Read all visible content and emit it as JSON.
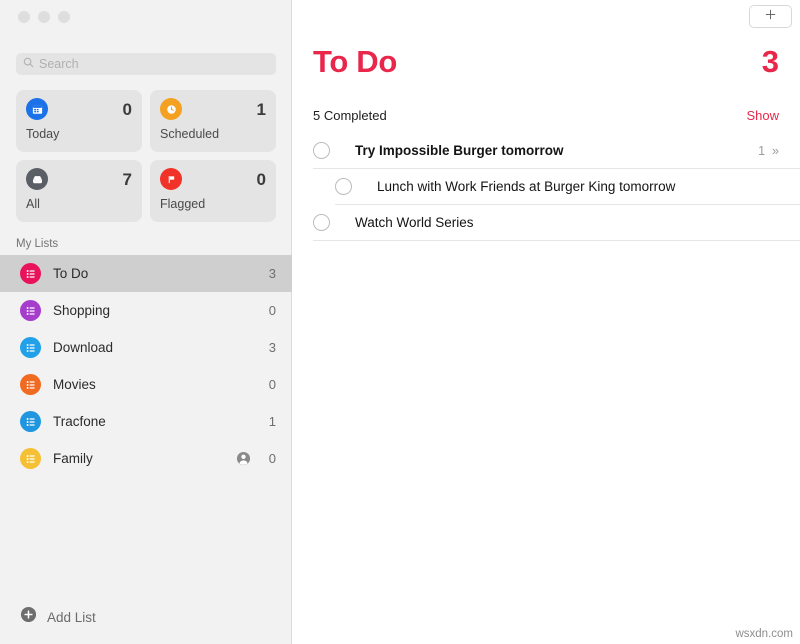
{
  "window": {
    "traffic_lights": [
      "close",
      "minimize",
      "zoom"
    ]
  },
  "colors": {
    "accent_red": "#e8274b",
    "today_blue": "#1a71e8",
    "scheduled_orange": "#f4a020",
    "all_gray": "#5a5f66",
    "flagged_red": "#f03228",
    "todo_pink": "#e8135a",
    "shopping_purple": "#a63ccc",
    "download_blue": "#22a0e8",
    "movies_orange": "#f06a22",
    "tracfone_blue": "#2096e0",
    "family_yellow": "#f5c033"
  },
  "sidebar": {
    "search": {
      "placeholder": "Search",
      "value": "",
      "icon": "search-icon"
    },
    "cards": [
      {
        "label": "Today",
        "count": "0",
        "icon": "calendar-icon",
        "color": "#1a71e8"
      },
      {
        "label": "Scheduled",
        "count": "1",
        "icon": "clock-icon",
        "color": "#f4a020"
      },
      {
        "label": "All",
        "count": "7",
        "icon": "inbox-icon",
        "color": "#5a5f66"
      },
      {
        "label": "Flagged",
        "count": "0",
        "icon": "flag-icon",
        "color": "#f03228"
      }
    ],
    "section_header": "My Lists",
    "lists": [
      {
        "label": "To Do",
        "count": "3",
        "color": "#e8135a",
        "icon": "list-icon",
        "selected": true,
        "shared": false
      },
      {
        "label": "Shopping",
        "count": "0",
        "color": "#a63ccc",
        "icon": "list-icon",
        "selected": false,
        "shared": false
      },
      {
        "label": "Download",
        "count": "3",
        "color": "#22a0e8",
        "icon": "list-icon",
        "selected": false,
        "shared": false
      },
      {
        "label": "Movies",
        "count": "0",
        "color": "#f06a22",
        "icon": "list-icon",
        "selected": false,
        "shared": false
      },
      {
        "label": "Tracfone",
        "count": "1",
        "color": "#2096e0",
        "icon": "list-icon",
        "selected": false,
        "shared": false
      },
      {
        "label": "Family",
        "count": "0",
        "color": "#f5c033",
        "icon": "list-icon",
        "selected": false,
        "shared": true
      }
    ],
    "add_list": {
      "label": "Add List",
      "icon": "plus-circle-icon"
    }
  },
  "main": {
    "add_button": {
      "icon": "plus-icon",
      "label": ""
    },
    "title": "To Do",
    "title_count": "3",
    "completed_text": "5 Completed",
    "show_link": "Show",
    "tasks": [
      {
        "text": "Try Impossible Burger tomorrow",
        "bold": true,
        "sub": false,
        "checked": false,
        "subtask_count": "1",
        "chevron": "»"
      },
      {
        "text": "Lunch with Work Friends at Burger King tomorrow",
        "bold": false,
        "sub": true,
        "checked": false,
        "subtask_count": "",
        "chevron": ""
      },
      {
        "text": "Watch World Series",
        "bold": false,
        "sub": false,
        "checked": false,
        "subtask_count": "",
        "chevron": ""
      }
    ]
  },
  "watermark": "wsxdn.com"
}
